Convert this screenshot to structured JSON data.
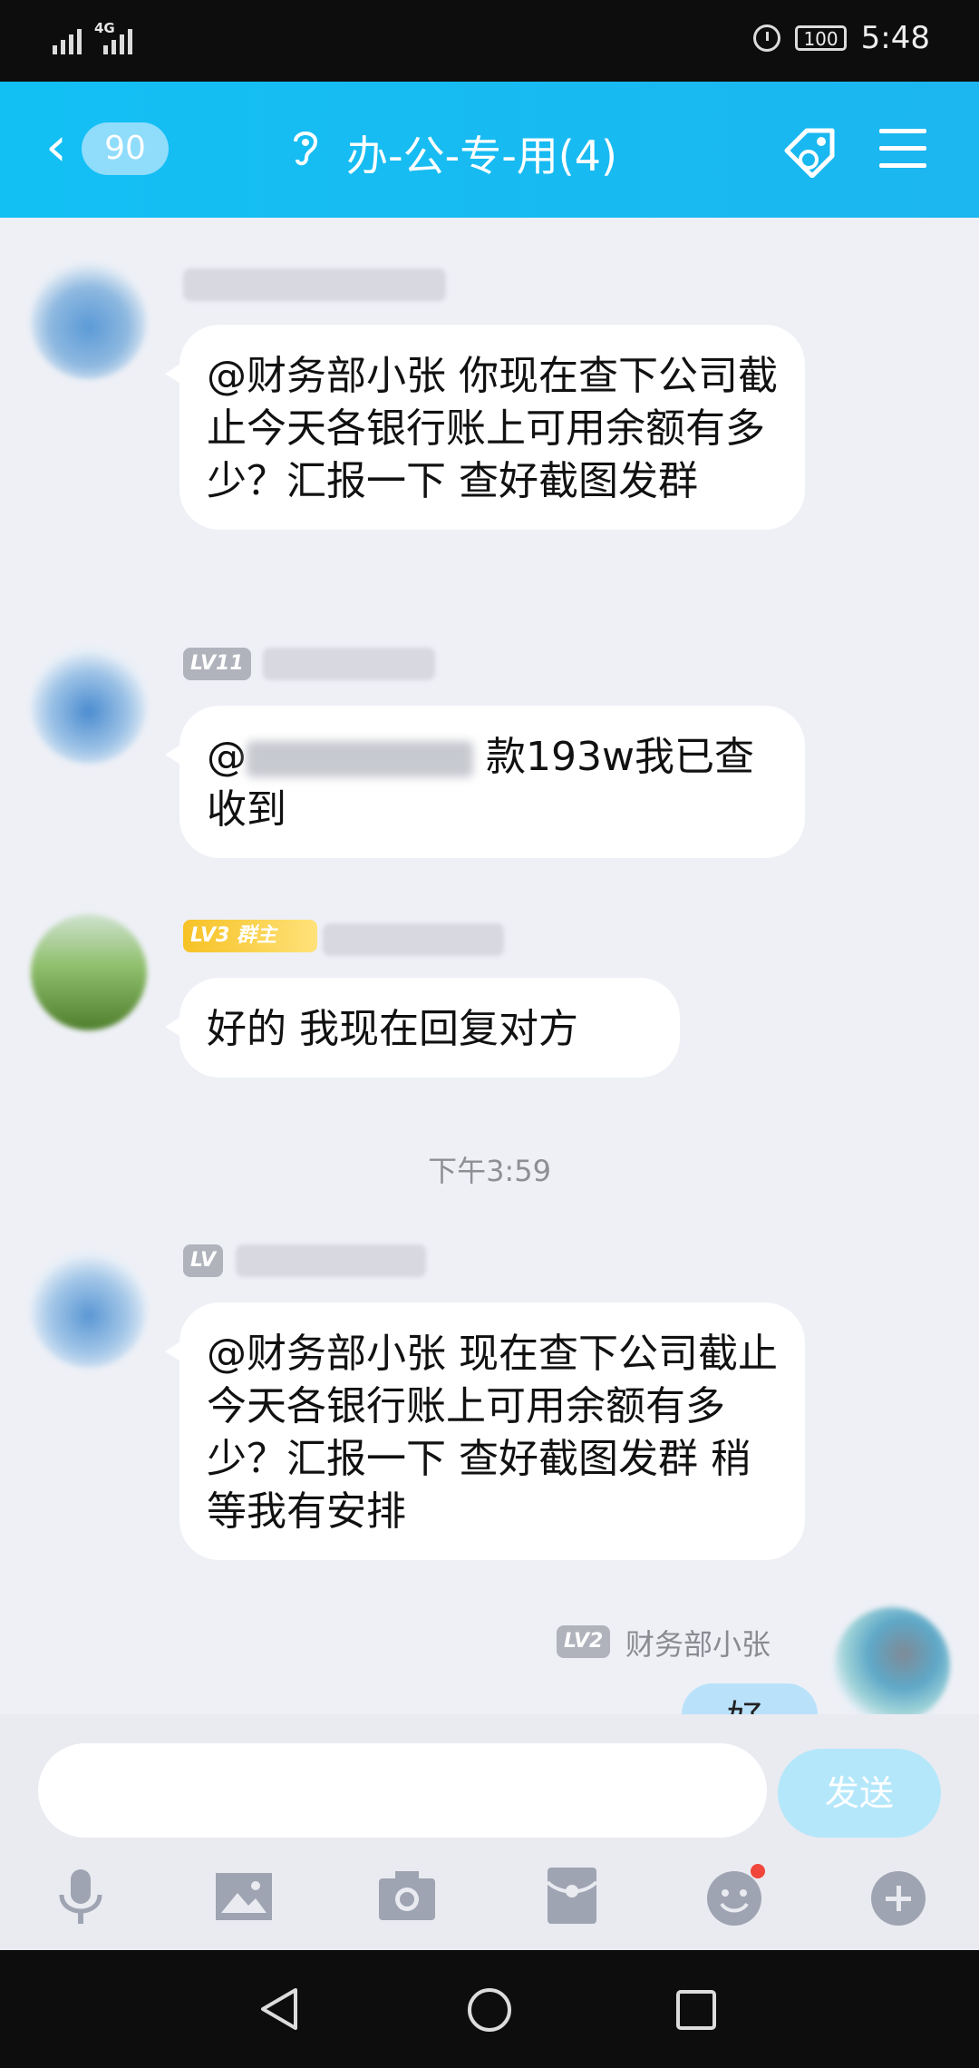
{
  "status_bar": {
    "network": "4G",
    "battery": "100",
    "time": "5:48"
  },
  "header": {
    "unread_count": "90",
    "chat_title": "办-公-专-用(4)"
  },
  "messages": [
    {
      "sender": "",
      "level": "",
      "text": "@财务部小张 你现在查下公司截止今天各银行账上可用余额有多少？汇报一下 查好截图发群"
    },
    {
      "sender": "",
      "level": "LV11",
      "text_prefix": "@",
      "text_suffix": "款193w我已查收到"
    },
    {
      "sender": "",
      "level": "LV3",
      "role": "群主",
      "text": "好的  我现在回复对方"
    },
    {
      "sender": "",
      "level": "LV",
      "text": "@财务部小张 现在查下公司截止今天各银行账上可用余额有多少？汇报一下 查好截图发群 稍等我有安排"
    }
  ],
  "timestamp": "下午3:59",
  "self_message": {
    "level": "LV2",
    "sender": "财务部小张",
    "text_partial": "好"
  },
  "composer": {
    "send_label": "发送",
    "value": ""
  },
  "icon_names": [
    "voice-icon",
    "image-icon",
    "camera-icon",
    "red-packet-icon",
    "emoji-icon",
    "plus-icon"
  ],
  "colors": {
    "header": "#14bdf3",
    "background": "#eef0f6",
    "lv3_badge": "#f7c52c",
    "send_button": "#b5e7fb"
  }
}
